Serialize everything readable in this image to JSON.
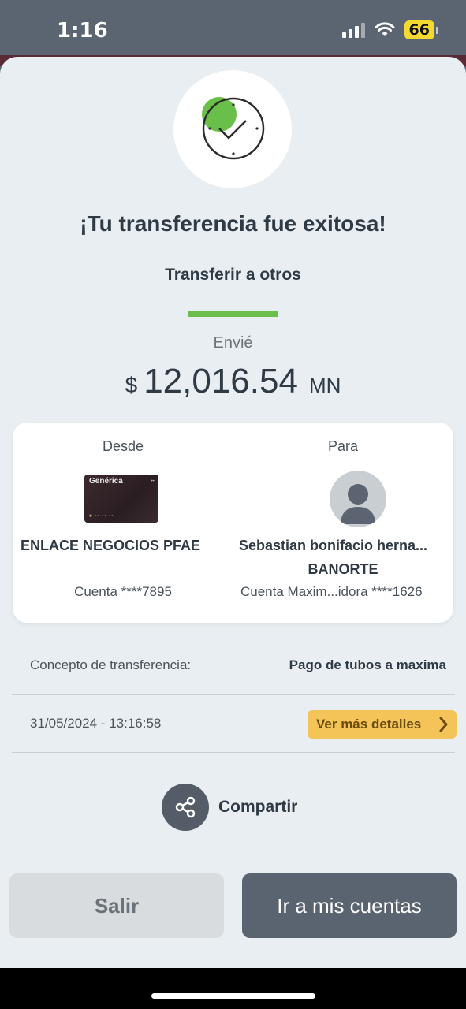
{
  "status_bar": {
    "time": "1:16",
    "battery": "66"
  },
  "header": {
    "title": "¡Tu transferencia fue exitosa!",
    "subtitle": "Transferir a otros"
  },
  "amount": {
    "label": "Envié",
    "currency_symbol": "$",
    "value": "12,016.54",
    "currency_code": "MN"
  },
  "from": {
    "heading": "Desde",
    "card_label": "Genérica",
    "name": "ENLACE NEGOCIOS PFAE",
    "account": "Cuenta ****7895"
  },
  "to": {
    "heading": "Para",
    "name": "Sebastian bonifacio herna...",
    "bank": "BANORTE",
    "account": "Cuenta Maxim...idora ****1626"
  },
  "concept": {
    "label": "Concepto de transferencia:",
    "value": "Pago de tubos a maxima"
  },
  "datetime": "31/05/2024 - 13:16:58",
  "details_button": "Ver más detalles",
  "share_label": "Compartir",
  "buttons": {
    "exit": "Salir",
    "accounts": "Ir a mis cuentas"
  },
  "colors": {
    "accent_green": "#6abf4b",
    "details_yellow": "#f5c459",
    "primary_dark": "#5a6470"
  }
}
